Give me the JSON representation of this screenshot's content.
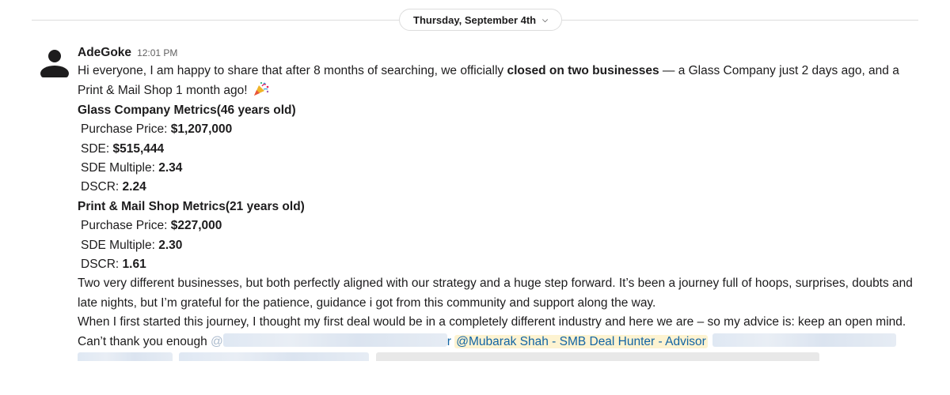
{
  "date_divider": {
    "label": "Thursday, September 4th"
  },
  "message": {
    "author": "AdeGoke",
    "time": "12:01 PM",
    "intro_part1": "Hi everyone, I am happy to share that after 8 months of searching, we officially ",
    "intro_bold": "closed on two businesses",
    "intro_part2": " — a Glass Company just 2 days ago, and a Print & Mail Shop 1 month ago!",
    "glass": {
      "heading": "Glass Company Metrics(46 years old)",
      "metrics": [
        {
          "label": "Purchase Price: ",
          "value": "$1,207,000"
        },
        {
          "label": "SDE: ",
          "value": "$515,444"
        },
        {
          "label": "SDE Multiple: ",
          "value": "2.34"
        },
        {
          "label": "DSCR: ",
          "value": "2.24"
        }
      ]
    },
    "print": {
      "heading": "Print & Mail Shop Metrics(21 years old)",
      "metrics": [
        {
          "label": "Purchase Price: ",
          "value": "$227,000"
        },
        {
          "label": "SDE Multiple: ",
          "value": "2.30"
        },
        {
          "label": "DSCR: ",
          "value": "1.61"
        }
      ]
    },
    "para_journey": "Two very different businesses, but both perfectly aligned with our strategy and a huge step forward. It’s been a journey full of hoops, surprises, doubts and late nights, but I’m grateful for the patience, guidance i got from this community and support along the way.",
    "para_advice": "When I first started this journey, I thought my first deal would be in a completely different industry and here we are – so my advice is: keep an open mind.",
    "thanks_prefix": "Can’t thank you enough ",
    "mention_blur_start": "@",
    "mention_tail": "r",
    "mention_visible": "@Mubarak Shah - SMB Deal Hunter - Advisor"
  }
}
